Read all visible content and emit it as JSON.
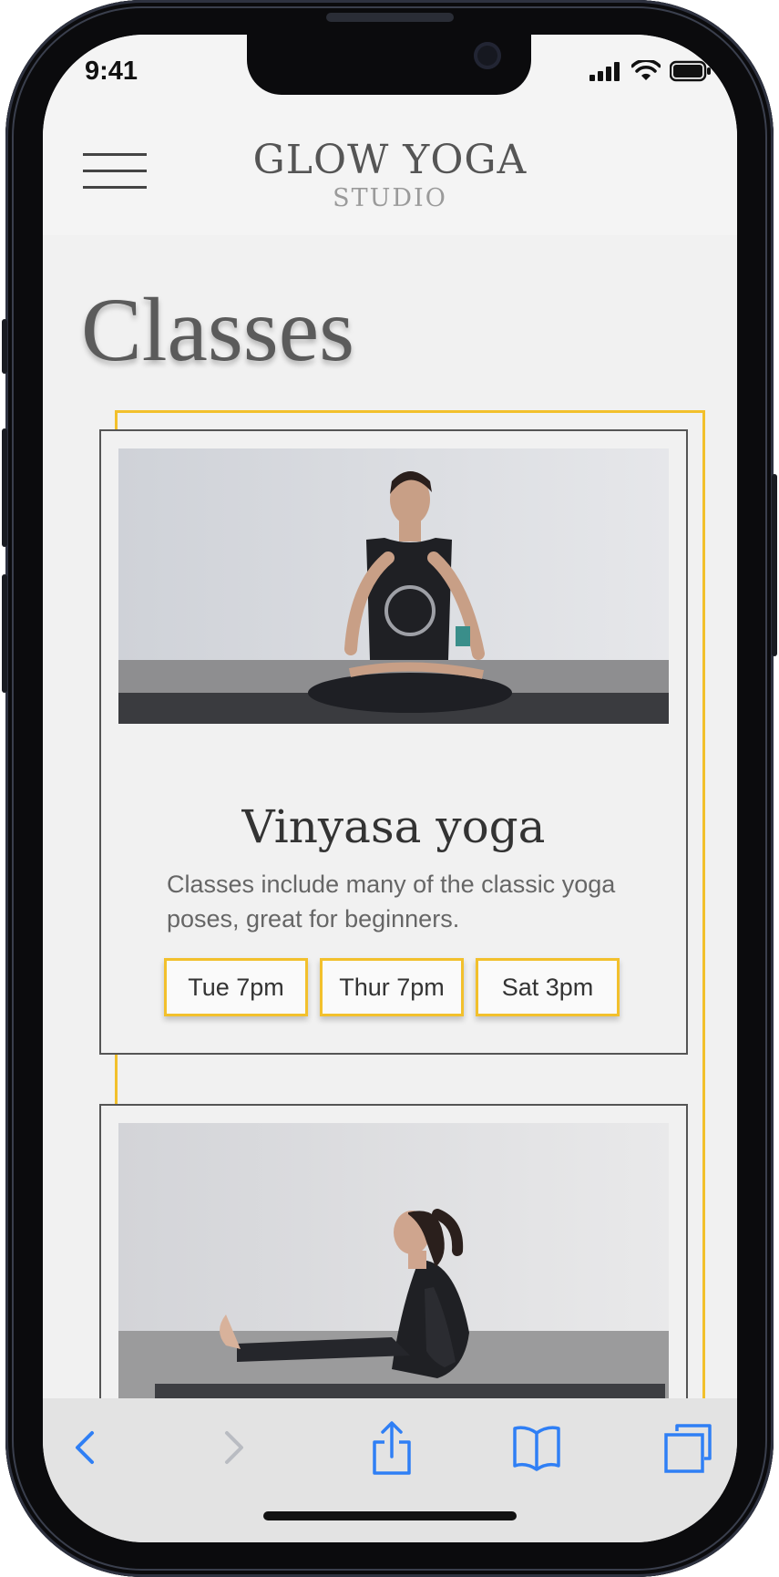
{
  "status_bar": {
    "time": "9:41"
  },
  "header": {
    "logo_main": "GLOW YOGA",
    "logo_sub": "STUDIO"
  },
  "page": {
    "title": "Classes"
  },
  "classes": [
    {
      "title": "Vinyasa yoga",
      "description": "Classes include many of the classic yoga poses, great for beginners.",
      "times": [
        "Tue 7pm",
        "Thur 7pm",
        "Sat 3pm"
      ]
    }
  ],
  "colors": {
    "accent": "#f2c02c",
    "text": "#333333",
    "ios_blue": "#2f7ff5",
    "background": "#f1f1f1"
  },
  "toolbar": {
    "icons": [
      "back-icon",
      "forward-icon",
      "share-icon",
      "bookmarks-icon",
      "tabs-icon"
    ]
  }
}
